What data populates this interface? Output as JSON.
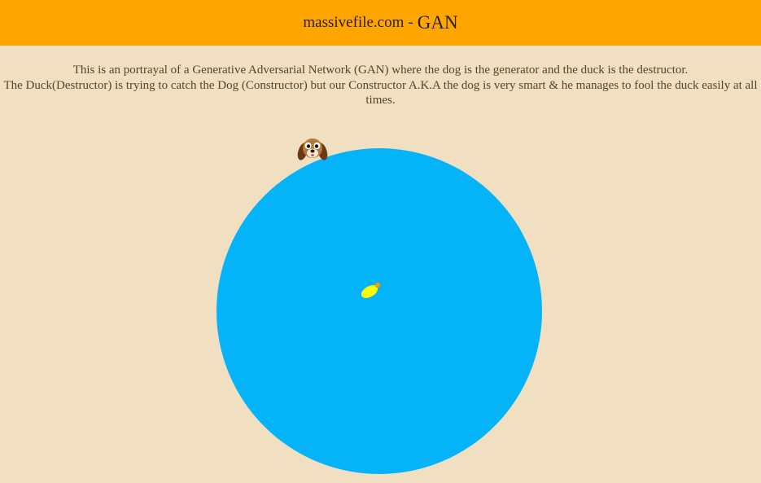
{
  "header": {
    "site": "massivefile.com",
    "separator": "-",
    "title": "GAN"
  },
  "description": {
    "line1": "This is an portrayal of a Generative Adversarial Network (GAN) where the dog is the generator and the duck is the destructor.",
    "line2": "The Duck(Destructor) is trying to catch the Dog (Constructor) but our Constructor A.K.A the dog is very smart & he manages to fool the duck easily at all times."
  },
  "scene": {
    "pond_color": "#05b3f8",
    "duck_color": "#ffff00",
    "duck_beak_color": "#ffa500",
    "dog_icon": "dog-face-icon",
    "duck_icon": "duck-icon"
  }
}
